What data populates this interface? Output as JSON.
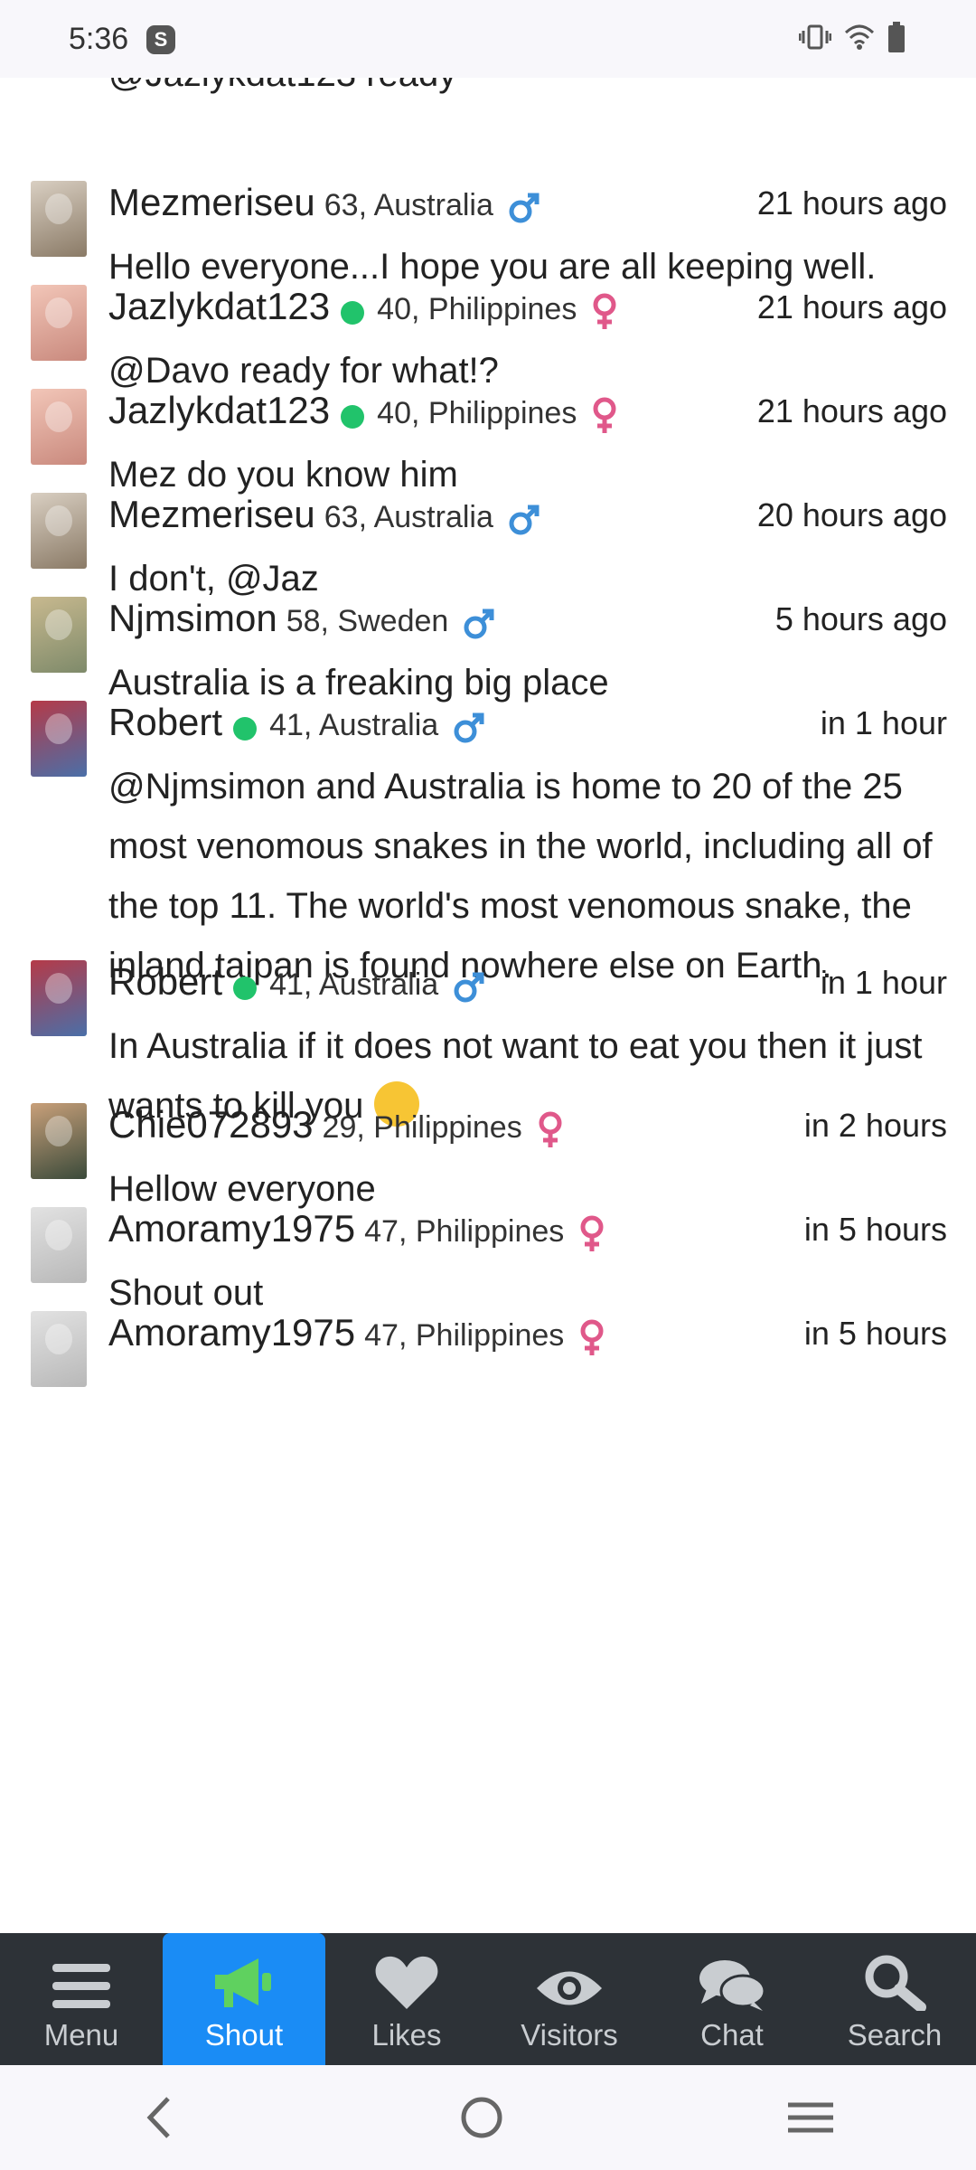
{
  "status_bar": {
    "time": "5:36",
    "app_badge": "S"
  },
  "feed": {
    "partial_text": "@Jazlykdat123 ready",
    "posts": [
      {
        "username": "Mezmeriseu",
        "online": false,
        "age": "63",
        "location": "Australia",
        "gender": "male",
        "time": "21 hours ago",
        "text": "Hello everyone...I hope you are all keeping well."
      },
      {
        "username": "Jazlykdat123",
        "online": true,
        "age": "40",
        "location": "Philippines",
        "gender": "female",
        "time": "21 hours ago",
        "text": "@Davo ready for what!?"
      },
      {
        "username": "Jazlykdat123",
        "online": true,
        "age": "40",
        "location": "Philippines",
        "gender": "female",
        "time": "21 hours ago",
        "text": "Mez do you know him"
      },
      {
        "username": "Mezmeriseu",
        "online": false,
        "age": "63",
        "location": "Australia",
        "gender": "male",
        "time": "20 hours ago",
        "text": "I don't, @Jaz"
      },
      {
        "username": "Njmsimon",
        "online": false,
        "age": "58",
        "location": "Sweden",
        "gender": "male",
        "time": "5 hours ago",
        "text": "Australia is a freaking big place"
      },
      {
        "username": "Robert",
        "online": true,
        "age": "41",
        "location": "Australia",
        "gender": "male",
        "time": "in 1 hour",
        "text": "@Njmsimon and Australia is home to 20 of the 25 most venomous snakes in the world, including all of the top 11. The world's most venomous snake, the inland taipan is found nowhere else on Earth."
      },
      {
        "username": "Robert",
        "online": true,
        "age": "41",
        "location": "Australia",
        "gender": "male",
        "time": "in 1 hour",
        "text": "In Australia if it does not want to eat you then it just wants to kill you"
      },
      {
        "username": "Chie072893",
        "online": false,
        "age": "29",
        "location": "Philippines",
        "gender": "female",
        "time": "in 2 hours",
        "text": "Hellow everyone"
      },
      {
        "username": "Amoramy1975",
        "online": false,
        "age": "47",
        "location": "Philippines",
        "gender": "female",
        "time": "in 5 hours",
        "text": "Shout out"
      },
      {
        "username": "Amoramy1975",
        "online": false,
        "age": "47",
        "location": "Philippines",
        "gender": "female",
        "time": "in 5 hours",
        "text": ""
      }
    ]
  },
  "bottom_nav": {
    "items": [
      {
        "label": "Menu",
        "icon": "menu-icon"
      },
      {
        "label": "Shout",
        "icon": "megaphone-icon",
        "active": true
      },
      {
        "label": "Likes",
        "icon": "heart-icon"
      },
      {
        "label": "Visitors",
        "icon": "eye-icon"
      },
      {
        "label": "Chat",
        "icon": "chat-icon"
      },
      {
        "label": "Search",
        "icon": "search-icon"
      }
    ]
  },
  "colors": {
    "online": "#21c36b",
    "male": "#3d8fd8",
    "female": "#e0588a",
    "nav_bg": "#2d3237",
    "nav_active": "#1a8cf5"
  }
}
